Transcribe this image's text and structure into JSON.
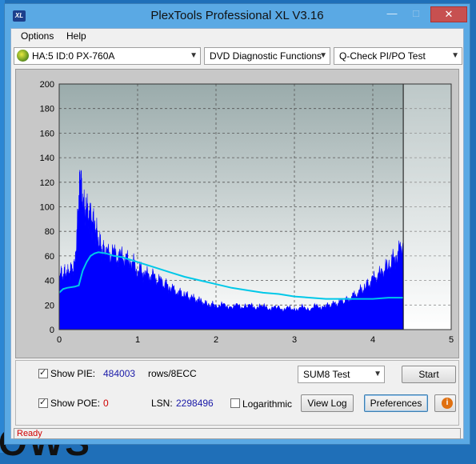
{
  "window": {
    "title": "PlexTools Professional XL V3.16",
    "icon_text": "XL"
  },
  "title_buttons": {
    "minimize": "—",
    "maximize": "□",
    "close": "✕"
  },
  "menu": {
    "items": [
      {
        "label": "Options"
      },
      {
        "label": "Help"
      }
    ]
  },
  "toolbar": {
    "drive": "HA:5 ID:0  PX-760A",
    "function": "DVD Diagnostic Functions",
    "test": "Q-Check PI/PO Test"
  },
  "chart_data": {
    "type": "area",
    "xlim": [
      0,
      5
    ],
    "ylim": [
      0,
      200
    ],
    "x_ticks": [
      "0",
      "1",
      "2",
      "3",
      "4",
      "5"
    ],
    "y_ticks": [
      "0",
      "20",
      "40",
      "60",
      "80",
      "100",
      "120",
      "140",
      "160",
      "180",
      "200"
    ],
    "grid": true,
    "end_marker_x": 4.39,
    "series": [
      {
        "color": "#0000ff",
        "x": [
          0,
          0.05,
          0.1,
          0.15,
          0.2,
          0.25,
          0.27,
          0.3,
          0.35,
          0.4,
          0.45,
          0.5,
          0.55,
          0.6,
          0.7,
          0.8,
          0.9,
          1.0,
          1.1,
          1.2,
          1.3,
          1.4,
          1.5,
          1.6,
          1.7,
          1.8,
          1.9,
          2.0,
          2.2,
          2.4,
          2.6,
          2.8,
          3.0,
          3.2,
          3.4,
          3.5,
          3.6,
          3.7,
          3.8,
          3.9,
          4.0,
          4.1,
          4.2,
          4.3,
          4.39
        ],
        "values": [
          44,
          46,
          45,
          47,
          50,
          103,
          128,
          100,
          95,
          90,
          84,
          72,
          65,
          62,
          60,
          58,
          56,
          50,
          45,
          42,
          38,
          35,
          31,
          28,
          25,
          23,
          20,
          20,
          19,
          19,
          18,
          17,
          17,
          18,
          19,
          20,
          22,
          25,
          30,
          34,
          40,
          45,
          52,
          60,
          70
        ]
      },
      {
        "color": "#00c8e8",
        "x": [
          0,
          0.05,
          0.1,
          0.2,
          0.25,
          0.3,
          0.35,
          0.4,
          0.45,
          0.5,
          0.6,
          0.7,
          0.8,
          0.9,
          1.0,
          1.2,
          1.4,
          1.6,
          1.8,
          2.0,
          2.2,
          2.4,
          2.6,
          2.8,
          3.0,
          3.2,
          3.4,
          3.6,
          3.8,
          4.0,
          4.2,
          4.39
        ],
        "values": [
          30,
          33,
          34,
          35,
          36,
          48,
          55,
          60,
          62,
          63,
          62,
          60,
          59,
          57,
          55,
          51,
          47,
          43,
          40,
          37,
          34,
          32,
          30,
          29,
          27,
          26,
          25,
          25,
          25,
          25,
          26,
          26
        ]
      }
    ]
  },
  "pie": {
    "show_label": "Show PIE:",
    "value": "484003",
    "unit": "rows/8ECC",
    "checked": true
  },
  "poe": {
    "show_label": "Show POE:",
    "value": "0",
    "checked": true
  },
  "lsn": {
    "label": "LSN:",
    "value": "2298496"
  },
  "logarithmic": {
    "label": "Logarithmic",
    "checked": false
  },
  "sum_select": "SUM8 Test",
  "buttons": {
    "start": "Start",
    "view_log": "View Log",
    "preferences": "Preferences"
  },
  "status": "Ready",
  "desktop_fragment": "OWS"
}
